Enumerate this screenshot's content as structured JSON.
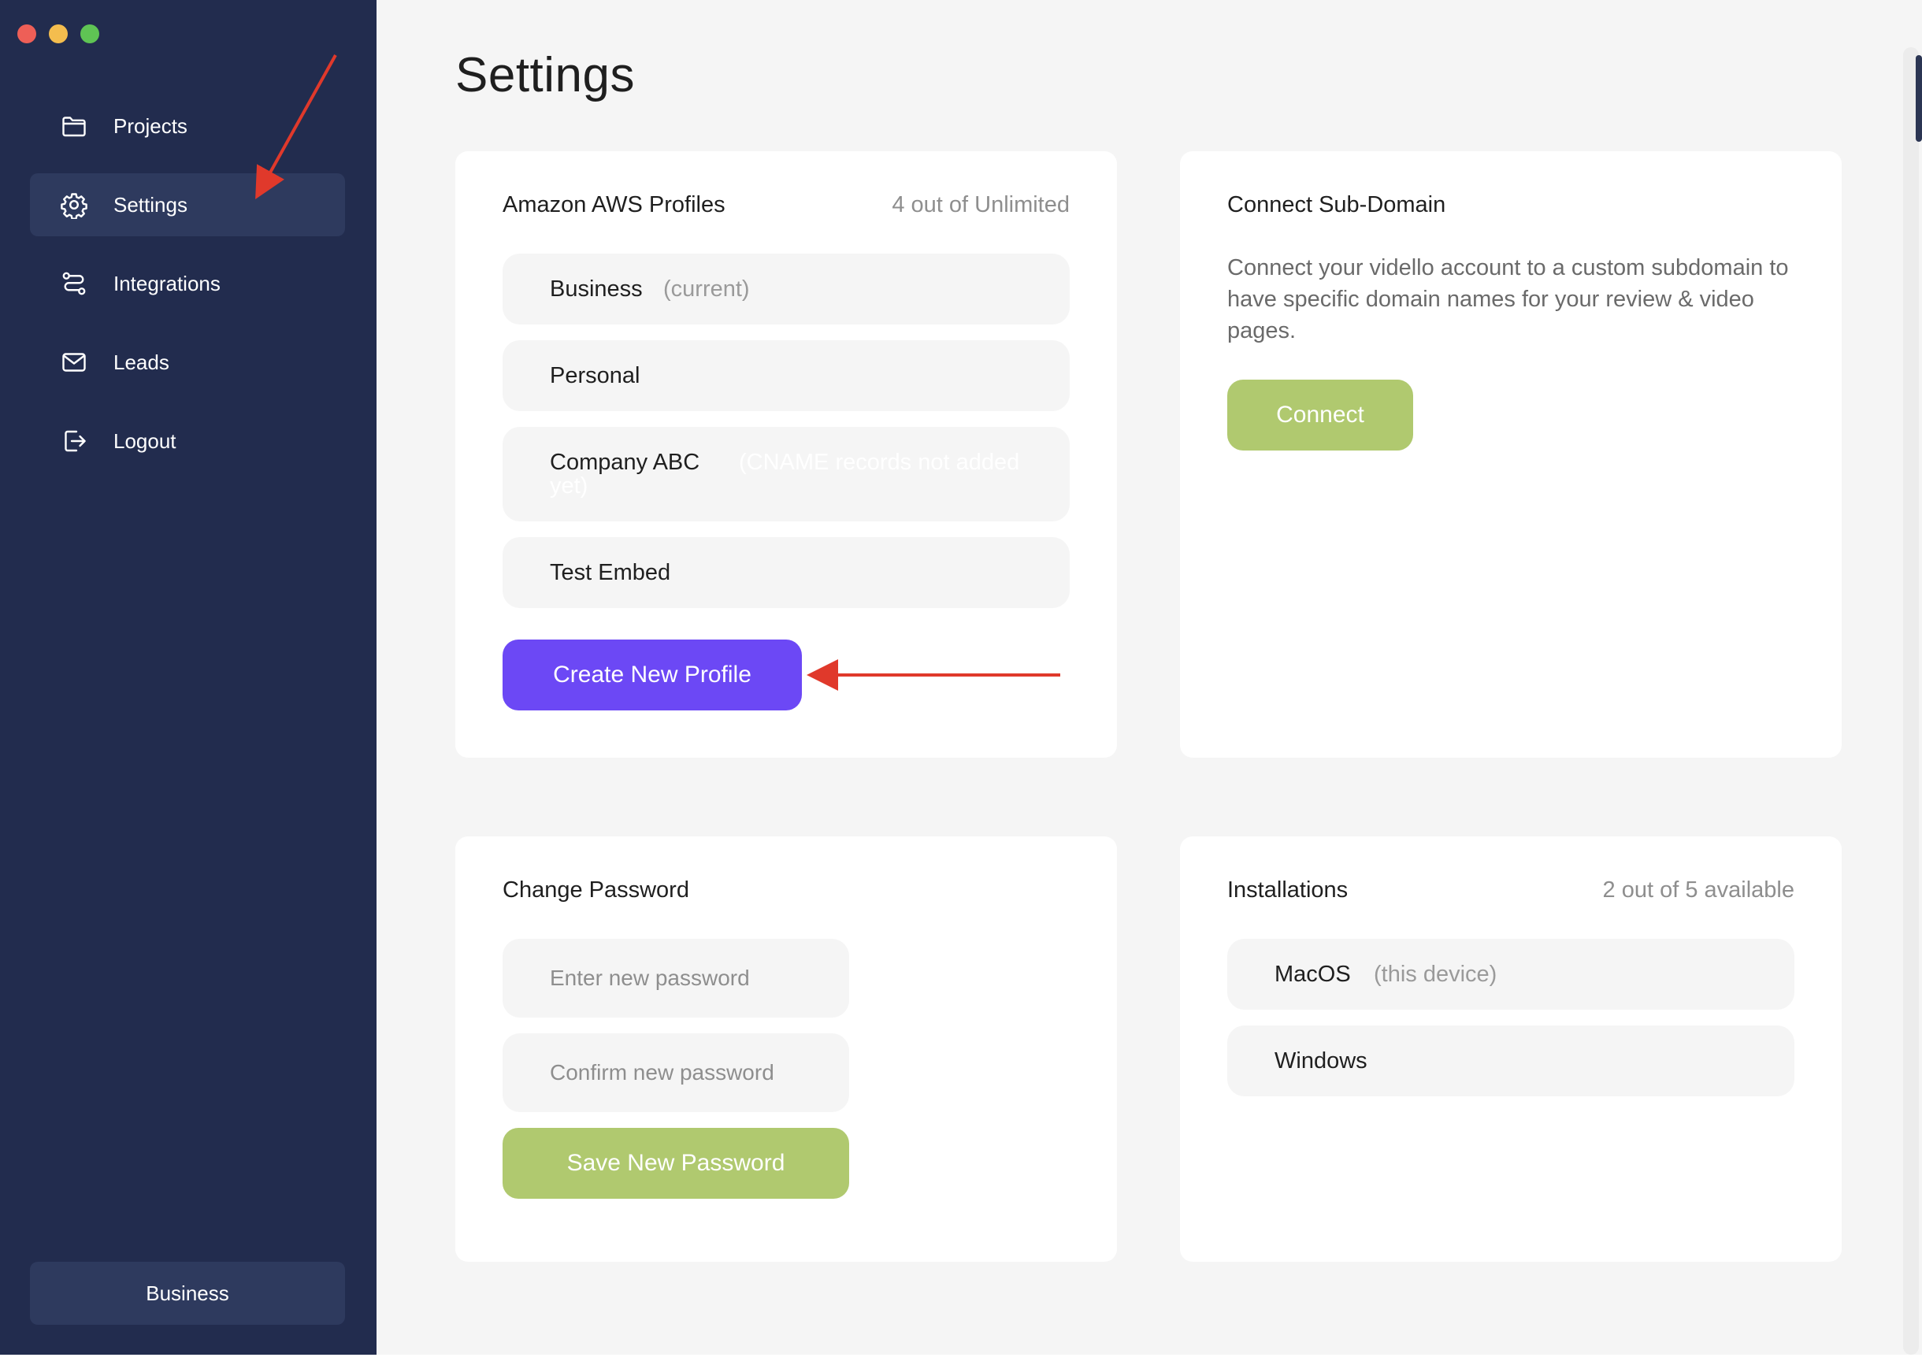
{
  "window": {
    "controls": [
      "close",
      "minimize",
      "zoom"
    ],
    "colors": {
      "close": "#ee5f57",
      "minimize": "#f4bd4e",
      "zoom": "#5fc454"
    }
  },
  "sidebar": {
    "items": [
      {
        "label": "Projects",
        "icon": "folder-icon",
        "active": false
      },
      {
        "label": "Settings",
        "icon": "gear-icon",
        "active": true
      },
      {
        "label": "Integrations",
        "icon": "route-icon",
        "active": false
      },
      {
        "label": "Leads",
        "icon": "mail-icon",
        "active": false
      },
      {
        "label": "Logout",
        "icon": "logout-icon",
        "active": false
      }
    ],
    "current_profile": "Business",
    "colors": {
      "background": "#222c4e",
      "active": "#2e3a5e"
    }
  },
  "page": {
    "title": "Settings"
  },
  "aws_profiles": {
    "title": "Amazon AWS Profiles",
    "count": "4 out of Unlimited",
    "profiles": [
      {
        "name": "Business",
        "tag": "(current)"
      },
      {
        "name": "Personal"
      },
      {
        "name": "Company ABC",
        "tag": "(CNAME records not added yet)"
      },
      {
        "name": "Test Embed"
      }
    ],
    "create_button": "Create New Profile",
    "accent": "#6c48f5"
  },
  "subdomain": {
    "title": "Connect Sub-Domain",
    "description": "Connect your vidello account to a custom subdomain to have specific domain names for your review & video pages.",
    "connect_button": "Connect",
    "accent": "#b0c96f"
  },
  "password": {
    "title": "Change Password",
    "new_placeholder": "Enter new password",
    "confirm_placeholder": "Confirm new password",
    "save_button": "Save New Password"
  },
  "installations": {
    "title": "Installations",
    "count": "2 out of 5 available",
    "items": [
      {
        "name": "MacOS",
        "tag": "(this device)"
      },
      {
        "name": "Windows"
      }
    ]
  },
  "annotations": {
    "arrow_color": "#e0392b"
  }
}
